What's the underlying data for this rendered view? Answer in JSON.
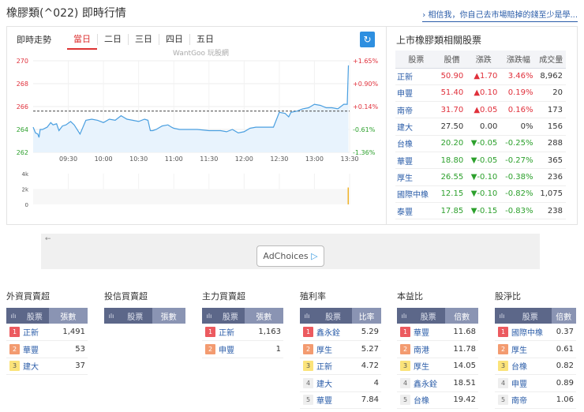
{
  "title": "橡膠類(^022) 即時行情",
  "top_link": "› 相信我，你自己去市場賠掉的錢至少是學...",
  "chart_panel": {
    "label": "即時走勢",
    "tabs": [
      "當日",
      "二日",
      "三日",
      "四日",
      "五日"
    ],
    "active_tab": "當日",
    "watermark": "WantGoo 玩股網",
    "refresh_icon": "refresh-icon"
  },
  "chart_data": {
    "type": "line",
    "title": "即時走勢",
    "y_ticks": [
      "270",
      "268",
      "266",
      "264",
      "262"
    ],
    "y_right_ticks": [
      "+1.65%",
      "+0.90%",
      "+0.14%",
      "-0.61%",
      "-1.36%"
    ],
    "ylim": [
      262,
      270
    ],
    "reference_price": 265.6,
    "x_ticks": [
      "09:30",
      "10:00",
      "10:30",
      "11:00",
      "11:30",
      "12:00",
      "12:30",
      "13:00",
      "13:30"
    ],
    "series": [
      {
        "name": "price",
        "x_minutes": [
          0,
          2,
          4,
          5,
          6,
          8,
          12,
          15,
          17,
          20,
          22,
          25,
          28,
          32,
          35,
          40,
          45,
          50,
          55,
          60,
          65,
          70,
          75,
          80,
          85,
          90,
          95,
          98,
          100,
          102,
          105,
          110,
          115,
          118,
          120,
          125,
          130,
          140,
          150,
          160,
          165,
          170,
          175,
          180,
          185,
          190,
          195,
          200,
          205,
          210,
          215,
          218,
          220,
          225,
          230,
          235,
          240,
          245,
          250,
          255,
          260,
          265,
          268,
          269
        ],
        "values": [
          264.2,
          263.7,
          263.6,
          263.3,
          264.0,
          264.0,
          264.2,
          264.6,
          264.4,
          264.5,
          263.9,
          264.3,
          264.4,
          264.7,
          264.4,
          263.6,
          264.8,
          264.9,
          264.8,
          264.6,
          264.9,
          264.8,
          265.2,
          264.9,
          264.8,
          264.7,
          264.9,
          264.8,
          263.9,
          263.9,
          264.0,
          264.3,
          264.4,
          264.2,
          264.1,
          264.0,
          264.0,
          264.0,
          263.9,
          263.9,
          263.8,
          264.0,
          263.7,
          263.8,
          264.1,
          264.2,
          264.2,
          264.2,
          264.2,
          265.5,
          265.4,
          265.1,
          265.5,
          265.6,
          265.8,
          265.9,
          266.2,
          266.1,
          265.9,
          265.9,
          265.8,
          266.2,
          266.2,
          269.6
        ]
      }
    ],
    "volume": {
      "y_ticks": [
        "4k",
        "2k",
        "0"
      ],
      "ylim": [
        0,
        4000
      ],
      "last_bar": 2200
    }
  },
  "related": {
    "title": "上市橡膠類相關股票",
    "headers": [
      "股票",
      "股價",
      "漲跌",
      "漲跌幅",
      "成交量"
    ],
    "rows": [
      {
        "name": "正新",
        "price": "50.90",
        "change": "▲1.70",
        "pct": "3.46%",
        "vol": "8,962",
        "dir": "up"
      },
      {
        "name": "申豐",
        "price": "51.40",
        "change": "▲0.10",
        "pct": "0.19%",
        "vol": "20",
        "dir": "up"
      },
      {
        "name": "南帝",
        "price": "31.70",
        "change": "▲0.05",
        "pct": "0.16%",
        "vol": "173",
        "dir": "up"
      },
      {
        "name": "建大",
        "price": "27.50",
        "change": "0.00",
        "pct": "0%",
        "vol": "156",
        "dir": "flat"
      },
      {
        "name": "台橡",
        "price": "20.20",
        "change": "▼-0.05",
        "pct": "-0.25%",
        "vol": "288",
        "dir": "dn"
      },
      {
        "name": "華豐",
        "price": "18.80",
        "change": "▼-0.05",
        "pct": "-0.27%",
        "vol": "365",
        "dir": "dn"
      },
      {
        "name": "厚生",
        "price": "26.55",
        "change": "▼-0.10",
        "pct": "-0.38%",
        "vol": "236",
        "dir": "dn"
      },
      {
        "name": "國際中橡",
        "price": "12.15",
        "change": "▼-0.10",
        "pct": "-0.82%",
        "vol": "1,075",
        "dir": "dn"
      },
      {
        "name": "泰豐",
        "price": "17.85",
        "change": "▼-0.15",
        "pct": "-0.83%",
        "vol": "238",
        "dir": "dn"
      }
    ]
  },
  "ad": {
    "label": "AdChoices",
    "arrow": "←"
  },
  "rankings": [
    {
      "title": "外資買賣超",
      "col": "股票",
      "val_col": "張數",
      "rows": [
        [
          "正新",
          "1,491"
        ],
        [
          "華豐",
          "53"
        ],
        [
          "建大",
          "37"
        ]
      ]
    },
    {
      "title": "投信買賣超",
      "col": "股票",
      "val_col": "張數",
      "rows": []
    },
    {
      "title": "主力買賣超",
      "col": "股票",
      "val_col": "張數",
      "rows": [
        [
          "正新",
          "1,163"
        ],
        [
          "申豐",
          "1"
        ]
      ]
    },
    {
      "title": "殖利率",
      "col": "股票",
      "val_col": "比率",
      "rows": [
        [
          "鑫永銓",
          "5.29"
        ],
        [
          "厚生",
          "5.27"
        ],
        [
          "正新",
          "4.72"
        ],
        [
          "建大",
          "4"
        ],
        [
          "華豐",
          "7.84"
        ]
      ]
    },
    {
      "title": "本益比",
      "col": "股票",
      "val_col": "倍數",
      "rows": [
        [
          "華豐",
          "11.68"
        ],
        [
          "南港",
          "11.78"
        ],
        [
          "厚生",
          "14.05"
        ],
        [
          "鑫永銓",
          "18.51"
        ],
        [
          "台橡",
          "19.42"
        ]
      ]
    },
    {
      "title": "股淨比",
      "col": "股票",
      "val_col": "倍數",
      "rows": [
        [
          "國際中橡",
          "0.37"
        ],
        [
          "厚生",
          "0.61"
        ],
        [
          "台橡",
          "0.82"
        ],
        [
          "申豐",
          "0.89"
        ],
        [
          "南帝",
          "1.06"
        ]
      ]
    }
  ]
}
